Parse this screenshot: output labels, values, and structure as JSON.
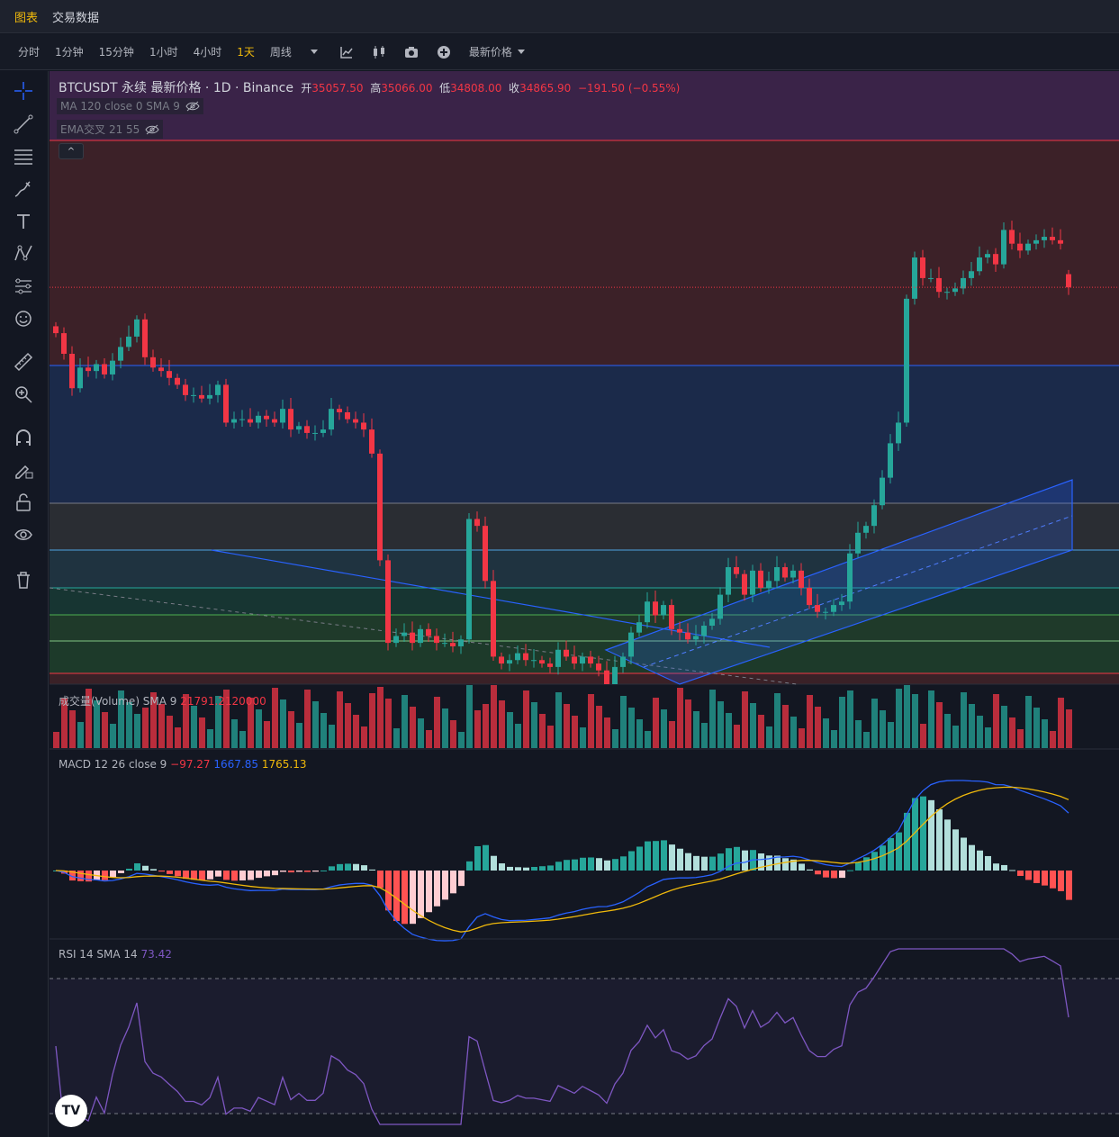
{
  "nav": {
    "tabs": [
      {
        "label": "图表",
        "active": true
      },
      {
        "label": "交易数据",
        "active": false
      }
    ]
  },
  "toolbar": {
    "timeframes": [
      {
        "label": "分时",
        "active": false
      },
      {
        "label": "1分钟",
        "active": false
      },
      {
        "label": "15分钟",
        "active": false
      },
      {
        "label": "1小时",
        "active": false
      },
      {
        "label": "4小时",
        "active": false
      },
      {
        "label": "1天",
        "active": true
      },
      {
        "label": "周线",
        "active": false
      }
    ],
    "price_select": "最新价格",
    "icons": [
      "chevron-down-icon",
      "indicators-icon",
      "candles-icon",
      "camera-icon",
      "add-icon"
    ]
  },
  "sidebar": {
    "tools": [
      "crosshair-icon",
      "trend-line-icon",
      "fib-icon",
      "brush-icon",
      "text-icon",
      "pattern-icon",
      "forecast-icon",
      "emoji-icon",
      "ruler-icon",
      "zoom-icon",
      "magnet-icon",
      "lock-draw-icon",
      "lock-icon",
      "eye-icon",
      "trash-icon"
    ]
  },
  "legend": {
    "symbol": "BTCUSDT 永续 最新价格 · 1D · Binance",
    "open_label": "开",
    "open": "35057.50",
    "high_label": "高",
    "high": "35066.00",
    "low_label": "低",
    "low": "34808.00",
    "close_label": "收",
    "close": "34865.90",
    "change": "−191.50 (−0.55%)",
    "ma": "MA 120 close 0 SMA 9",
    "ema": "EMA交叉 21 55"
  },
  "volume_pane": {
    "label": "成交量(Volume) SMA 9",
    "value": "21791.2120000"
  },
  "macd_pane": {
    "label": "MACD 12 26 close 9",
    "hist": "−97.27",
    "macd": "1667.85",
    "signal": "1765.13"
  },
  "rsi_pane": {
    "label": "RSI 14 SMA 14",
    "value": "73.42"
  },
  "colors": {
    "up": "#26a69a",
    "down": "#f23645",
    "macd": "#2962ff",
    "signal": "#f0b90b",
    "rsi": "#7e57c2",
    "accent": "#f0b90b"
  },
  "logo_text": "TV",
  "chart_data": {
    "type": "candlestick",
    "series_count": 126,
    "close": [
      34200,
      33900,
      33400,
      33700,
      33650,
      33750,
      33600,
      33800,
      34000,
      34150,
      34400,
      33850,
      33700,
      33650,
      33550,
      33450,
      33300,
      33300,
      33250,
      33300,
      33450,
      32900,
      32950,
      32950,
      32900,
      33000,
      32950,
      32900,
      33100,
      32800,
      32850,
      32750,
      32750,
      32800,
      33100,
      33050,
      32950,
      32900,
      32800,
      32450,
      30900,
      29700,
      29800,
      29850,
      29700,
      29900,
      29800,
      29700,
      29700,
      29650,
      29750,
      31500,
      31400,
      30600,
      29500,
      29400,
      29450,
      29550,
      29450,
      29450,
      29400,
      29350,
      29600,
      29500,
      29400,
      29500,
      29400,
      29300,
      29100,
      29350,
      29500,
      29850,
      30000,
      30300,
      30100,
      30250,
      29900,
      29850,
      29750,
      29800,
      29950,
      30050,
      30400,
      30800,
      30700,
      30400,
      30750,
      30500,
      30600,
      30800,
      30650,
      30750,
      30500,
      30250,
      30150,
      30150,
      30250,
      30300,
      31000,
      31300,
      31400,
      31700,
      32100,
      32600,
      32900,
      34700,
      35300,
      35000,
      35000,
      34800,
      34800,
      34850,
      35000,
      35100,
      35300,
      35350,
      35200,
      35700,
      35500,
      35400,
      35500,
      35550,
      35600,
      35550,
      35500,
      34865.9
    ],
    "open": [
      34300,
      34200,
      33900,
      33400,
      33700,
      33650,
      33750,
      33600,
      33800,
      34000,
      34150,
      34400,
      33850,
      33700,
      33650,
      33550,
      33450,
      33300,
      33300,
      33250,
      33300,
      33450,
      32900,
      32950,
      32950,
      32900,
      33000,
      32950,
      32900,
      33100,
      32800,
      32850,
      32750,
      32750,
      32800,
      33100,
      33050,
      32950,
      32900,
      32800,
      32450,
      30900,
      29700,
      29800,
      29850,
      29700,
      29900,
      29800,
      29700,
      29700,
      29650,
      29750,
      31500,
      31400,
      30600,
      29500,
      29400,
      29450,
      29550,
      29450,
      29450,
      29400,
      29350,
      29600,
      29500,
      29400,
      29500,
      29400,
      29300,
      29100,
      29350,
      29500,
      29850,
      30000,
      30300,
      30100,
      30250,
      29900,
      29850,
      29750,
      29800,
      29950,
      30050,
      30400,
      30800,
      30700,
      30400,
      30750,
      30500,
      30600,
      30800,
      30650,
      30750,
      30500,
      30250,
      30150,
      30150,
      30250,
      30300,
      31000,
      31300,
      31400,
      31700,
      32100,
      32600,
      32900,
      34700,
      35300,
      35000,
      35000,
      34800,
      34800,
      34850,
      35000,
      35100,
      35300,
      35350,
      35200,
      35700,
      35500,
      35400,
      35500,
      35550,
      35600,
      35550,
      35057.5
    ]
  }
}
